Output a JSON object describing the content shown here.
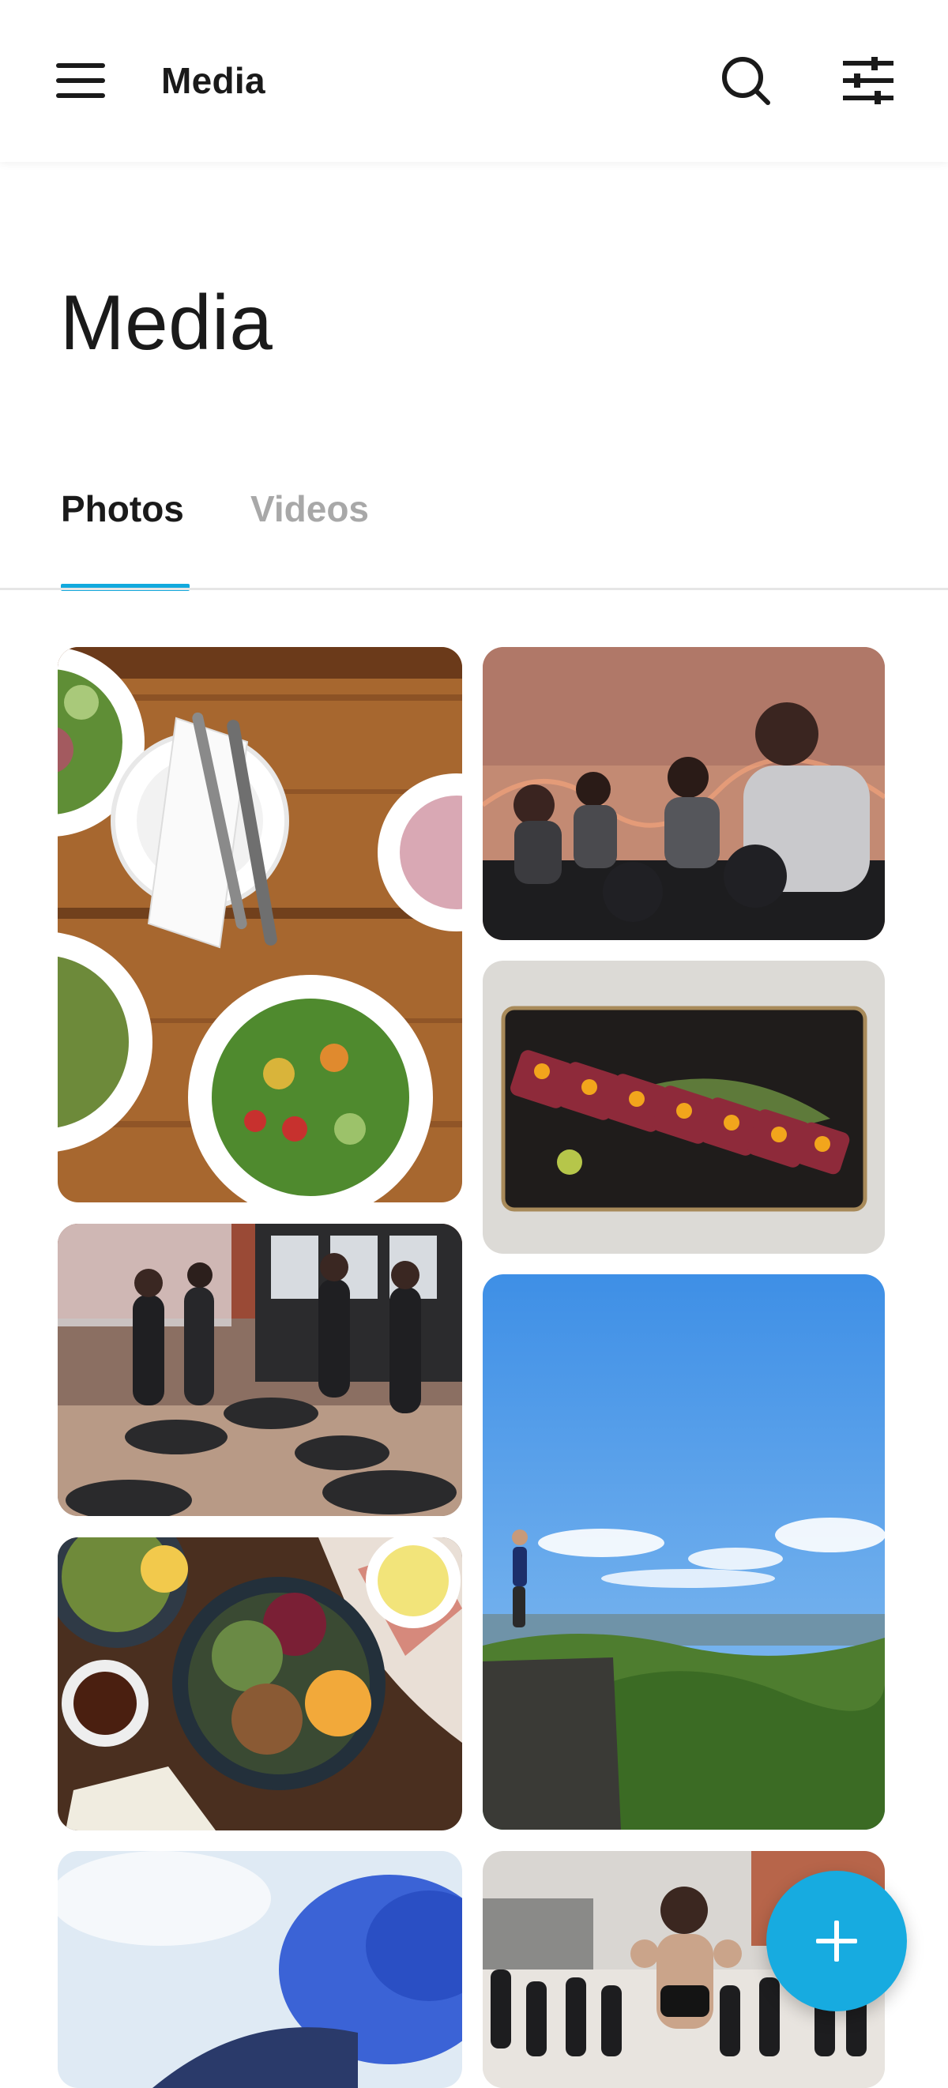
{
  "header": {
    "title": "Media",
    "menu_icon": "hamburger-menu-icon",
    "search_icon": "search-icon",
    "filter_icon": "sliders-filter-icon"
  },
  "page": {
    "title": "Media"
  },
  "tabs": [
    {
      "label": "Photos",
      "active": true
    },
    {
      "label": "Videos",
      "active": false
    }
  ],
  "accent_color": "#12a9dd",
  "photos": [
    {
      "subject": "salad-bowls-on-wooden-table"
    },
    {
      "subject": "indoor-cycling-class"
    },
    {
      "subject": "seared-tuna-on-black-plate"
    },
    {
      "subject": "rebounder-trampoline-class"
    },
    {
      "subject": "person-on-cliff-overlooking-forest"
    },
    {
      "subject": "food-plates-flat-lay"
    },
    {
      "subject": "person-blue-sky-partial"
    },
    {
      "subject": "rooftop-group-workout"
    }
  ],
  "fab": {
    "icon": "plus-icon",
    "color": "#17abe0"
  }
}
